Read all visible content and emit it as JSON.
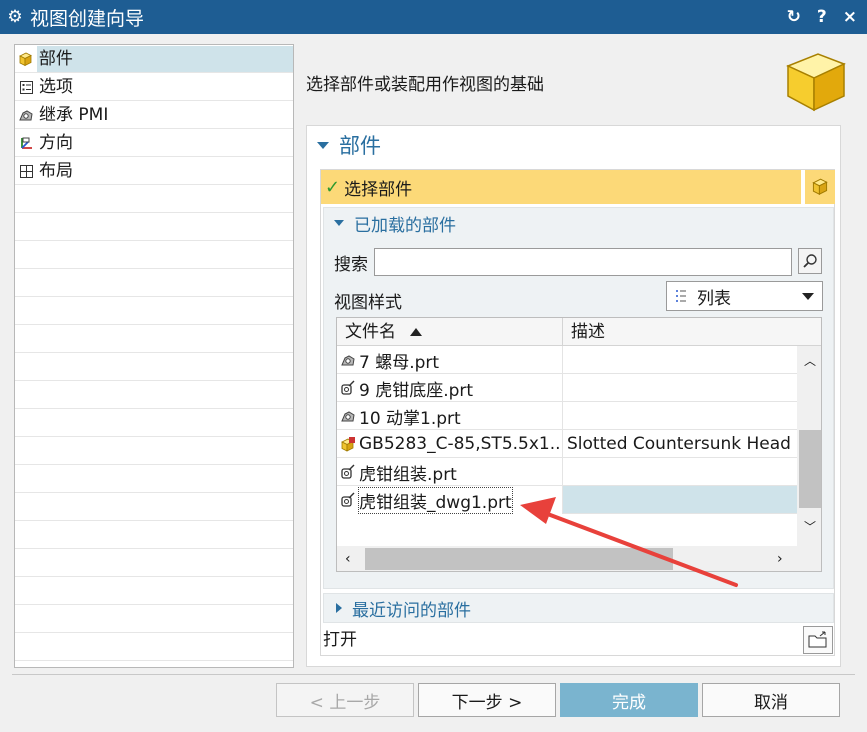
{
  "window": {
    "title": "视图创建向导",
    "title_icon": "gear-icon",
    "controls": {
      "reset": "↻",
      "help": "?",
      "close": "×"
    }
  },
  "nav": {
    "items": [
      {
        "label": "部件",
        "icon": "part-cube-icon",
        "selected": true
      },
      {
        "label": "选项",
        "icon": "options-icon",
        "selected": false
      },
      {
        "label": "继承 PMI",
        "icon": "pmi-icon",
        "selected": false
      },
      {
        "label": "方向",
        "icon": "orientation-icon",
        "selected": false
      },
      {
        "label": "布局",
        "icon": "layout-icon",
        "selected": false
      }
    ]
  },
  "instruction": "选择部件或装配用作视图的基础",
  "section": {
    "title": "部件",
    "select_label": "选择部件",
    "loaded_title": "已加载的部件",
    "search_label": "搜索",
    "search_value": "",
    "view_style_label": "视图样式",
    "view_style_value": "列表",
    "table": {
      "columns": [
        "文件名",
        "描述"
      ],
      "rows": [
        {
          "name": "7 螺母.prt",
          "desc": "",
          "icon": "component-icon"
        },
        {
          "name": "9 虎钳底座.prt",
          "desc": "",
          "icon": "assembly-icon"
        },
        {
          "name": "10 动掌1.prt",
          "desc": "",
          "icon": "component-icon"
        },
        {
          "name": "GB5283_C-85,ST5.5x1...",
          "desc": "Slotted Countersunk Head",
          "icon": "standard-part-icon"
        },
        {
          "name": "虎钳组装.prt",
          "desc": "",
          "icon": "assembly-icon"
        },
        {
          "name": "虎钳组装_dwg1.prt",
          "desc": "",
          "icon": "assembly-icon",
          "selected": true
        }
      ]
    },
    "recent_title": "最近访问的部件",
    "open_label": "打开"
  },
  "buttons": {
    "back": "< 上一步",
    "next": "下一步 >",
    "finish": "完成",
    "cancel": "取消"
  },
  "colors": {
    "titlebar": "#1e5d93",
    "accent": "#2a6fa0",
    "highlight_yellow": "#fcd978",
    "selection": "#cfe3ea",
    "finish_button": "#7ab4cf",
    "annotation_arrow": "#e8413b"
  }
}
